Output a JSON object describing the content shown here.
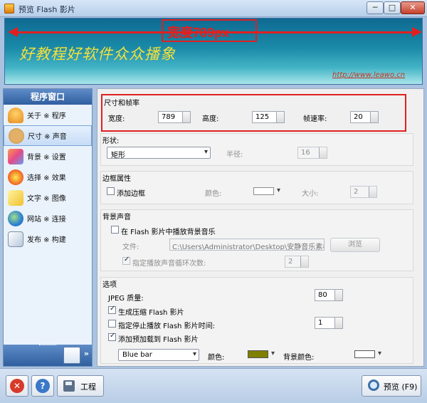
{
  "window": {
    "title": "预览 Flash 影片",
    "min_label": "─",
    "max_label": "□",
    "close_label": "✕"
  },
  "preview": {
    "width_label": "宽度789px",
    "slogan": "好教程好软件众众播象",
    "link": "http://www.leawo.cn",
    "accent_color": "#e02020"
  },
  "sidebar": {
    "header": "程序窗口",
    "items": [
      {
        "label": "关于 ※ 程序",
        "icon": "home-icon"
      },
      {
        "label": "尺寸 ※ 声音",
        "icon": "cookie-icon",
        "active": true
      },
      {
        "label": "背景 ※ 设置",
        "icon": "background-icon"
      },
      {
        "label": "选择 ※ 效果",
        "icon": "effect-icon"
      },
      {
        "label": "文字 ※ 图像",
        "icon": "text-pencil-icon"
      },
      {
        "label": "网站 ※ 连接",
        "icon": "globe-icon"
      },
      {
        "label": "发布 ※ 构建",
        "icon": "publish-icon"
      }
    ],
    "footer_chevron": "»"
  },
  "size": {
    "title": "尺寸和帧率",
    "width_label": "宽度:",
    "width_value": "789",
    "height_label": "高度:",
    "height_value": "125",
    "fps_label": "帧速率:",
    "fps_value": "20"
  },
  "shape": {
    "title": "形状:",
    "value": "矩形",
    "radius_label": "半径:",
    "radius_value": "16"
  },
  "border": {
    "title": "边框属性",
    "add_label": "添加边框",
    "color_label": "颜色:",
    "size_label": "大小:",
    "size_value": "2"
  },
  "sound": {
    "title": "背景声音",
    "play_label": "在 Flash 影片中播放背景音乐",
    "file_label": "文件:",
    "file_value": "C:\\Users\\Administrator\\Desktop\\安静音乐素材\\手机",
    "browse_label": "浏览",
    "loop_label": "指定播放声音循环次数:",
    "loop_value": "2"
  },
  "options": {
    "title": "选项",
    "jpeg_label": "JPEG 质量:",
    "jpeg_value": "80",
    "compress_label": "生成压缩 Flash 影片",
    "stop_label": "指定停止播放 Flash 影片时间:",
    "stop_value": "1",
    "preloader_label": "添加预加载到 Flash 影片",
    "preloader_value": "Blue bar",
    "color_label": "颜色:",
    "color_value": "#808000",
    "bgcolor_label": "背景颜色:"
  },
  "toolbar": {
    "close_icon": "✕",
    "help_icon": "?",
    "project_label": "工程",
    "preview_label": "预览 (F9)"
  }
}
